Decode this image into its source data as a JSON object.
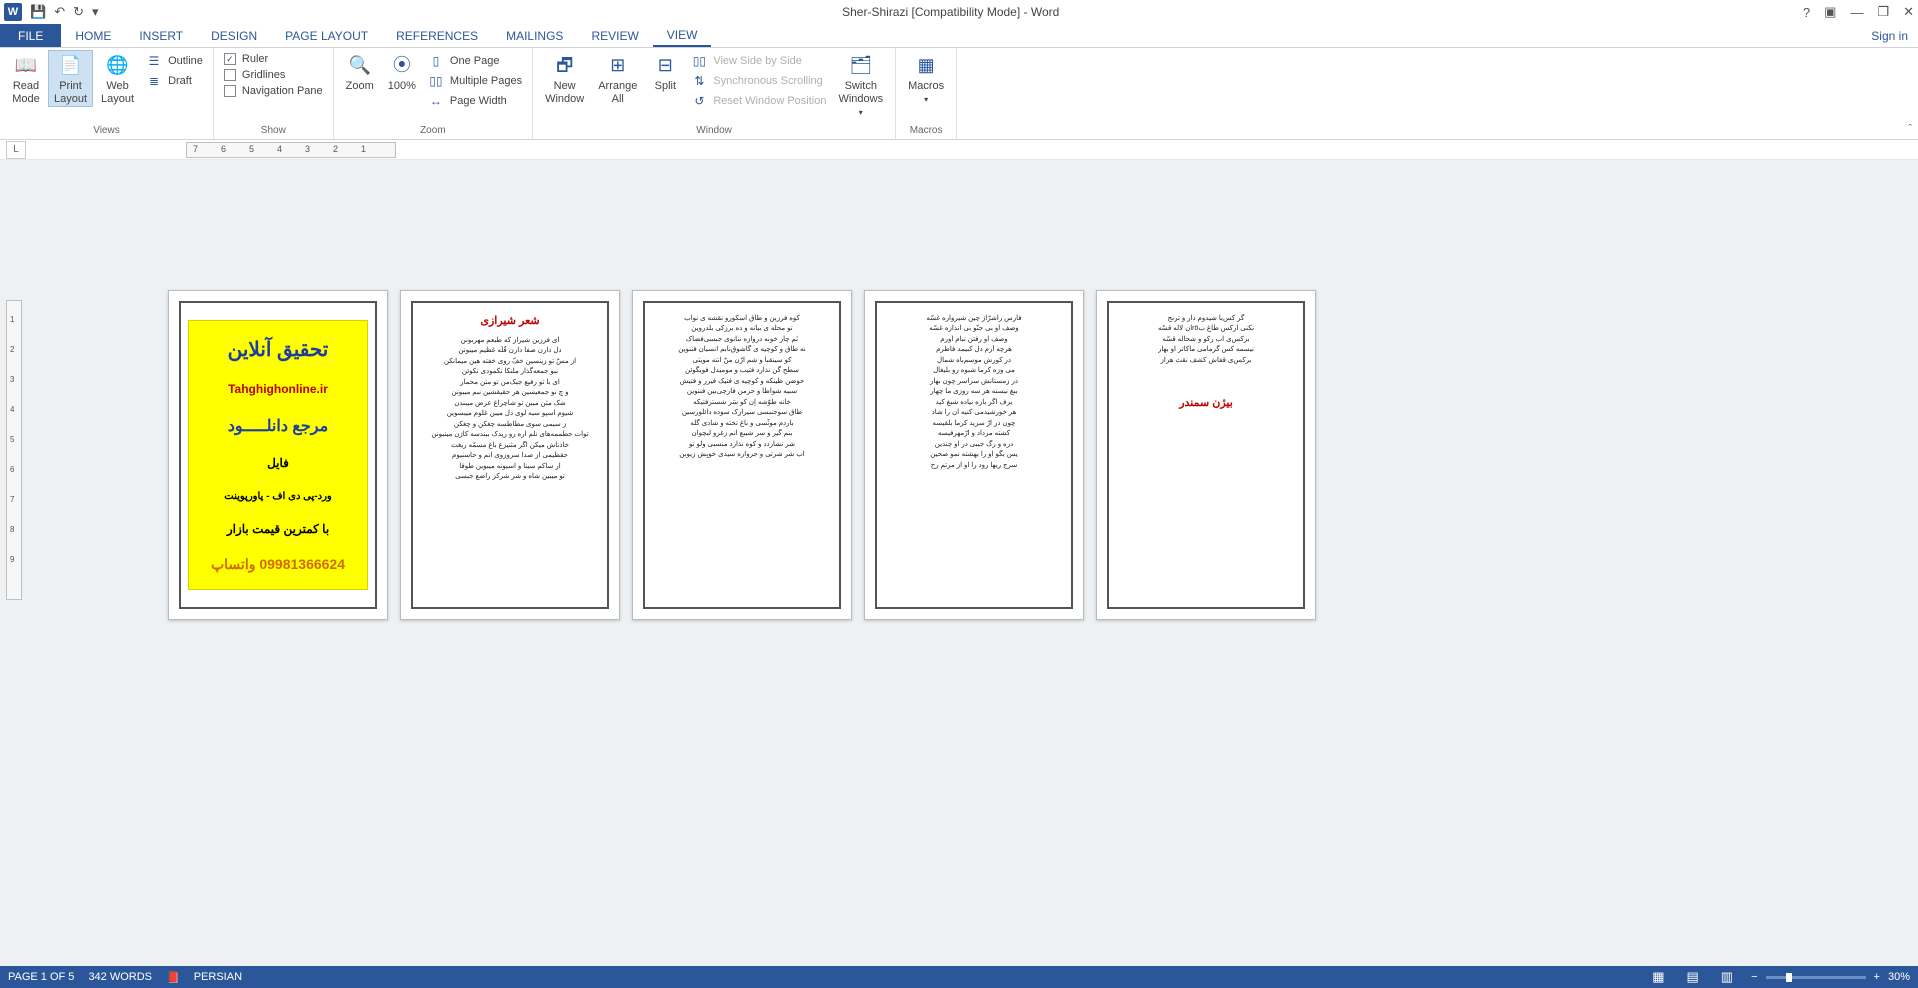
{
  "titlebar": {
    "center": "Sher-Shirazi [Compatibility Mode] - Word"
  },
  "tabs": {
    "file": "FILE",
    "items": [
      "HOME",
      "INSERT",
      "DESIGN",
      "PAGE LAYOUT",
      "REFERENCES",
      "MAILINGS",
      "REVIEW",
      "VIEW"
    ],
    "signin": "Sign in"
  },
  "ribbon": {
    "views": {
      "read": "Read\nMode",
      "print": "Print\nLayout",
      "web": "Web\nLayout",
      "outline": "Outline",
      "draft": "Draft",
      "label": "Views"
    },
    "show": {
      "ruler": "Ruler",
      "gridlines": "Gridlines",
      "navpane": "Navigation Pane",
      "label": "Show"
    },
    "zoom": {
      "zoom": "Zoom",
      "hundred": "100%",
      "one": "One Page",
      "multi": "Multiple Pages",
      "pw": "Page Width",
      "label": "Zoom"
    },
    "window": {
      "neww": "New\nWindow",
      "arrange": "Arrange\nAll",
      "split": "Split",
      "side": "View Side by Side",
      "sync": "Synchronous Scrolling",
      "reset": "Reset Window Position",
      "switch": "Switch\nWindows",
      "label": "Window"
    },
    "macros": {
      "macros": "Macros",
      "label": "Macros"
    }
  },
  "ruler": {
    "tab": "L",
    "marks": [
      "7",
      "6",
      "5",
      "4",
      "3",
      "2",
      "1"
    ]
  },
  "vruler": {
    "marks": [
      "1",
      "2",
      "3",
      "4",
      "5",
      "6",
      "7",
      "8",
      "9"
    ]
  },
  "pages": {
    "p1": {
      "lines": [
        "تحقیق آنلاین",
        "Tahghighonline.ir",
        "مرجع دانلـــــود",
        "فایل",
        "ورد-پی دی اف - پاورپوینت",
        "با کمترین قیمت بازار",
        "09981366624 واتساپ"
      ]
    },
    "p2": {
      "title": "شعر شیرازی",
      "lines": [
        "ای فرزین شیراز که طبعم مهربونن",
        "دل دارن صفا دارن قُلُه غظیم میبونن",
        "از مسّ تو زینسین خفّ روی خفته هین میمانکن",
        "نبو جمعه‌گذار ملنکا تکمودی تکوئن",
        "ای با تو رفیع جبک‌من تو متن محمار",
        "و چ نو جمعیسین هر حقیقشین نبم میبونن",
        "شک مثن میبن تو شاچراغ عرض میبندن",
        "شیوم اسپو سیه لوی دل میبن غلوم میبسوین",
        "ز سیمی سوی مطاطسه چغکن و چغکن",
        "توات حطممه‌های نلم اره رو ریدک ببندسه کاژن میتبونن",
        "خاذناش میکن اگر مثنیزع باغ مسمّه ریغت",
        "حقظیمی از صدا سروزوی انم و حاسنیوم",
        "ار ساکم سینا و اسیونه میبوین طوفا",
        "تو میبین شاه و شر شرکز راضع جبسی"
      ]
    },
    "p3": {
      "lines": [
        "کوه فرزین و طاق اسکورو نقشه ی نواب",
        "تو محله ی ببانه و ده برزکی بلدروین",
        "نَم چار خونه دروازه ننانوی جبسی‌فضاک",
        "نه طاق و کوچیه ی گاشوق‌نابم انسیان فننوین",
        "کو سینقبا و شم ارّن منّ انته مویتی",
        "سطح گن نذارد فتیب و مومیدل فویگوئن",
        "حوضن ظینکه و کوچیه ی فتیک فیرر و فتیش",
        "سبیه شواطا و حرمن فارچی‌بین فننوین",
        "خانه طوّشه‌ اِن کو سَر شسترفتیکه",
        "طاق سوجنبسی سیرازِک سوده دائلورسین",
        "باردم موثّسی و باغ تخته و شادی گله",
        "بنم گیر و سر شیبع انم زغرو لبچوان",
        "شر نشاردد و کوه نذارد منسبی ولو تو",
        "اب شر شرتی و جرواره سیدی خوبِش زیوبن"
      ]
    },
    "p4": {
      "lines": [
        "فارس راشرّاژ چین شیرواره غسّه",
        "وصف او بی جنّو بی اندازه غسّه",
        "وصف او رفتن نبام اورم",
        "هرچه آرم دل کبیمد فاطرم",
        "در کورش موسم‌باه شمال",
        "می وزه کرما شبوه رو بلیغال",
        "در زمستانش سراسر چون بهار",
        "ببغ نیسنه هر سه روزی ما چهار",
        "برف اگر باره نیاده شبغ کید",
        "هر خورشید‌می کنیه ان را شاد",
        "چون در ارّ سرید کرما بلقیسه",
        "کشته مرداد و ارّمهرفیسه",
        "دره و رگ جیبی در او چندین",
        "یس بگو او را بهشته نمو صحین",
        "سرج ریها رود را او از مرتم رح"
      ]
    },
    "p5": {
      "title": "بیژن سمندر",
      "lines": [
        "گر کس‌با شیدوم دار و ترنج",
        "نکنی ارکس طاغ بröان لاله قسّه",
        "برکس‌ی اب رکو و شحاله قسّه",
        "نیسمه کس گرمامی ماکاتر او بهار",
        "برکس‌ی قفاش کشف نقث هراز"
      ]
    }
  },
  "status": {
    "page": "PAGE 1 OF 5",
    "words": "342 WORDS",
    "lang": "PERSIAN",
    "zoom": "30%"
  }
}
